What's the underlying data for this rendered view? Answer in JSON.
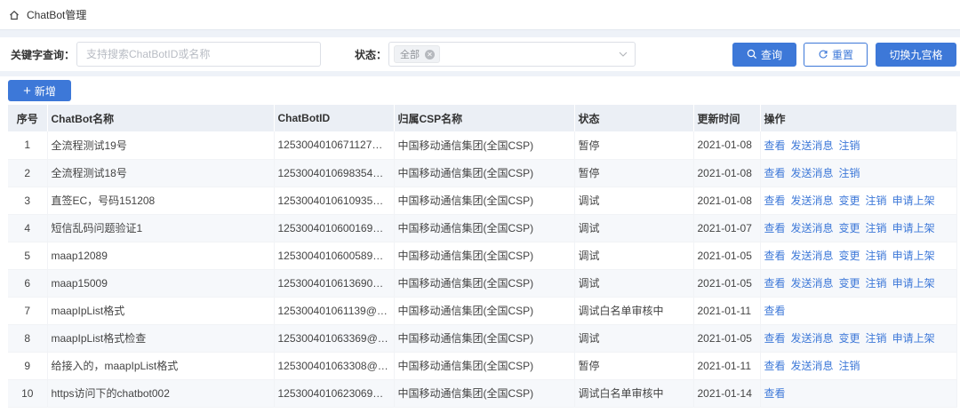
{
  "breadcrumb": {
    "title": "ChatBot管理"
  },
  "filter": {
    "keyword_label": "关键字查询：",
    "keyword_placeholder": "支持搜索ChatBotID或名称",
    "keyword_value": "",
    "status_label": "状态：",
    "status_tag": "全部"
  },
  "buttons": {
    "query": "查询",
    "reset": "重置",
    "grid": "切换九宫格",
    "add": "新增"
  },
  "table": {
    "columns": [
      "序号",
      "ChatBot名称",
      "ChatBotID",
      "归属CSP名称",
      "状态",
      "更新时间",
      "操作"
    ],
    "rows": [
      {
        "idx": "1",
        "name": "全流程测试19号",
        "id": "1253004010671127…",
        "csp": "中国移动通信集团(全国CSP)",
        "status": "暂停",
        "date": "2021-01-08",
        "ops": [
          "查看",
          "发送消息",
          "注销"
        ]
      },
      {
        "idx": "2",
        "name": "全流程测试18号",
        "id": "1253004010698354…",
        "csp": "中国移动通信集团(全国CSP)",
        "status": "暂停",
        "date": "2021-01-08",
        "ops": [
          "查看",
          "发送消息",
          "注销"
        ]
      },
      {
        "idx": "3",
        "name": "直签EC，号码151208",
        "id": "1253004010610935…",
        "csp": "中国移动通信集团(全国CSP)",
        "status": "调试",
        "date": "2021-01-08",
        "ops": [
          "查看",
          "发送消息",
          "变更",
          "注销",
          "申请上架"
        ]
      },
      {
        "idx": "4",
        "name": "短信乱码问题验证1",
        "id": "1253004010600169…",
        "csp": "中国移动通信集团(全国CSP)",
        "status": "调试",
        "date": "2021-01-07",
        "ops": [
          "查看",
          "发送消息",
          "变更",
          "注销",
          "申请上架"
        ]
      },
      {
        "idx": "5",
        "name": "maap12089",
        "id": "1253004010600589…",
        "csp": "中国移动通信集团(全国CSP)",
        "status": "调试",
        "date": "2021-01-05",
        "ops": [
          "查看",
          "发送消息",
          "变更",
          "注销",
          "申请上架"
        ]
      },
      {
        "idx": "6",
        "name": "maap15009",
        "id": "1253004010613690…",
        "csp": "中国移动通信集团(全国CSP)",
        "status": "调试",
        "date": "2021-01-05",
        "ops": [
          "查看",
          "发送消息",
          "变更",
          "注销",
          "申请上架"
        ]
      },
      {
        "idx": "7",
        "name": "maapIpList格式",
        "id": "125300401061139@…",
        "csp": "中国移动通信集团(全国CSP)",
        "status": "调试白名单审核中",
        "date": "2021-01-11",
        "ops": [
          "查看"
        ]
      },
      {
        "idx": "8",
        "name": "maapIpList格式检查",
        "id": "125300401063369@…",
        "csp": "中国移动通信集团(全国CSP)",
        "status": "调试",
        "date": "2021-01-05",
        "ops": [
          "查看",
          "发送消息",
          "变更",
          "注销",
          "申请上架"
        ]
      },
      {
        "idx": "9",
        "name": "给接入的，maapIpList格式",
        "id": "125300401063308@…",
        "csp": "中国移动通信集团(全国CSP)",
        "status": "暂停",
        "date": "2021-01-11",
        "ops": [
          "查看",
          "发送消息",
          "注销"
        ]
      },
      {
        "idx": "10",
        "name": "https访问下的chatbot002",
        "id": "1253004010623069…",
        "csp": "中国移动通信集团(全国CSP)",
        "status": "调试白名单审核中",
        "date": "2021-01-14",
        "ops": [
          "查看"
        ]
      }
    ]
  },
  "colors": {
    "primary": "#3d78d8",
    "header_bg": "#ebeff5",
    "band": "#eef2f8"
  },
  "icons": {
    "home": "home-icon",
    "search": "search-icon",
    "refresh": "refresh-icon",
    "chevron": "chevron-down-icon",
    "tag_close": "close-icon"
  }
}
